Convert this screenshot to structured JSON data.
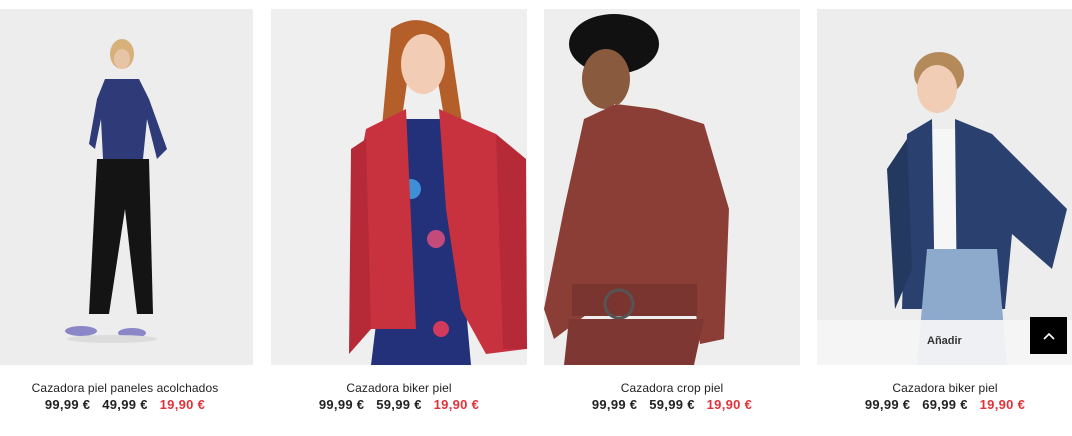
{
  "products": [
    {
      "name": "Cazadora piel paneles acolchados",
      "price_original": "99,99 €",
      "price_sale": "49,99 €",
      "price_final": "19,90 €",
      "jacket_color": "#2f3a78"
    },
    {
      "name": "Cazadora biker piel",
      "price_original": "99,99 €",
      "price_sale": "59,99 €",
      "price_final": "19,90 €",
      "jacket_color": "#c8323f"
    },
    {
      "name": "Cazadora crop piel",
      "price_original": "99,99 €",
      "price_sale": "59,99 €",
      "price_final": "19,90 €",
      "jacket_color": "#8a3e36"
    },
    {
      "name": "Cazadora biker piel",
      "price_original": "99,99 €",
      "price_sale": "69,99 €",
      "price_final": "19,90 €",
      "jacket_color": "#2a4170"
    }
  ],
  "add_to_cart_label": "Añadir",
  "icons": {
    "scroll_top": "chevron-up-icon"
  },
  "colors": {
    "final_price": "#e0323a",
    "scroll_button": "#000000"
  }
}
